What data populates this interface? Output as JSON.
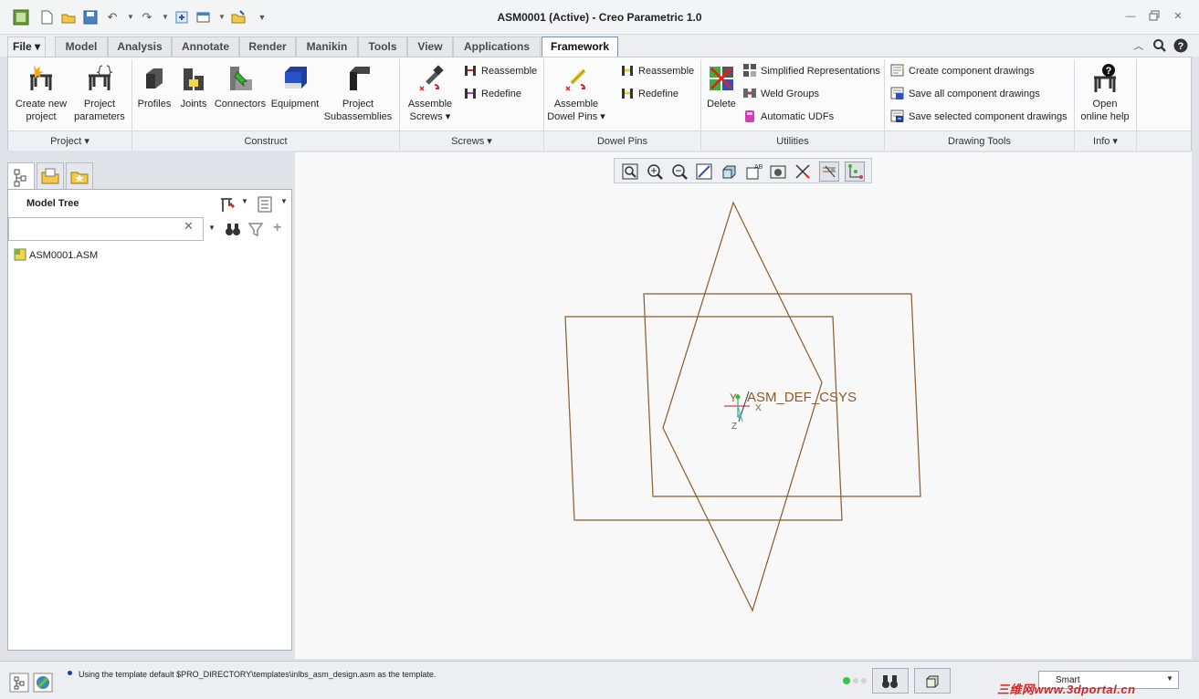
{
  "window": {
    "title": "ASM0001 (Active) - Creo Parametric 1.0"
  },
  "tabs": [
    {
      "label": "File ▾"
    },
    {
      "label": "Model"
    },
    {
      "label": "Analysis"
    },
    {
      "label": "Annotate"
    },
    {
      "label": "Render"
    },
    {
      "label": "Manikin"
    },
    {
      "label": "Tools"
    },
    {
      "label": "View"
    },
    {
      "label": "Applications"
    },
    {
      "label": "Framework"
    }
  ],
  "ribbon": {
    "project": {
      "create_new_project": "Create new\nproject",
      "project_parameters": "Project\nparameters",
      "label": "Project ▾"
    },
    "construct": {
      "profiles": "Profiles",
      "joints": "Joints",
      "connectors": "Connectors",
      "equipment": "Equipment",
      "project_subassemblies": "Project\nSubassemblies",
      "label": "Construct"
    },
    "screws": {
      "assemble_screws": "Assemble\nScrews ▾",
      "reassemble": "Reassemble",
      "redefine": "Redefine",
      "label": "Screws ▾"
    },
    "dowel_pins": {
      "assemble_dowel_pins": "Assemble\nDowel Pins ▾",
      "reassemble": "Reassemble",
      "redefine": "Redefine",
      "label": "Dowel Pins"
    },
    "utilities": {
      "delete": "Delete",
      "simplified_representations": "Simplified Representations",
      "weld_groups": "Weld Groups",
      "automatic_udfs": "Automatic UDFs",
      "label": "Utilities"
    },
    "drawing_tools": {
      "create_component_drawings": "Create component drawings",
      "save_all_component_drawings": "Save all component drawings",
      "save_selected_component_drawings": "Save selected component drawings",
      "label": "Drawing Tools"
    },
    "info": {
      "open_online_help": "Open\nonline help",
      "label": "Info ▾"
    }
  },
  "model_tree": {
    "title": "Model Tree",
    "search_value": "",
    "root_item": "ASM0001.ASM"
  },
  "graphics": {
    "csys_label": "ASM_DEF_CSYS",
    "axis_y": "Y",
    "axis_x": "X",
    "axis_z": "Z"
  },
  "status": {
    "message": "Using the template default $PRO_DIRECTORY\\templates\\inlbs_asm_design.asm as the template.",
    "filter": "Smart",
    "watermark": "三维网www.3dportal.cn"
  },
  "colors": {
    "datum_plane": "#8a5a2b",
    "csys_green": "#3cb43c",
    "csys_red": "#d04040",
    "csys_cyan": "#40c0e0"
  }
}
